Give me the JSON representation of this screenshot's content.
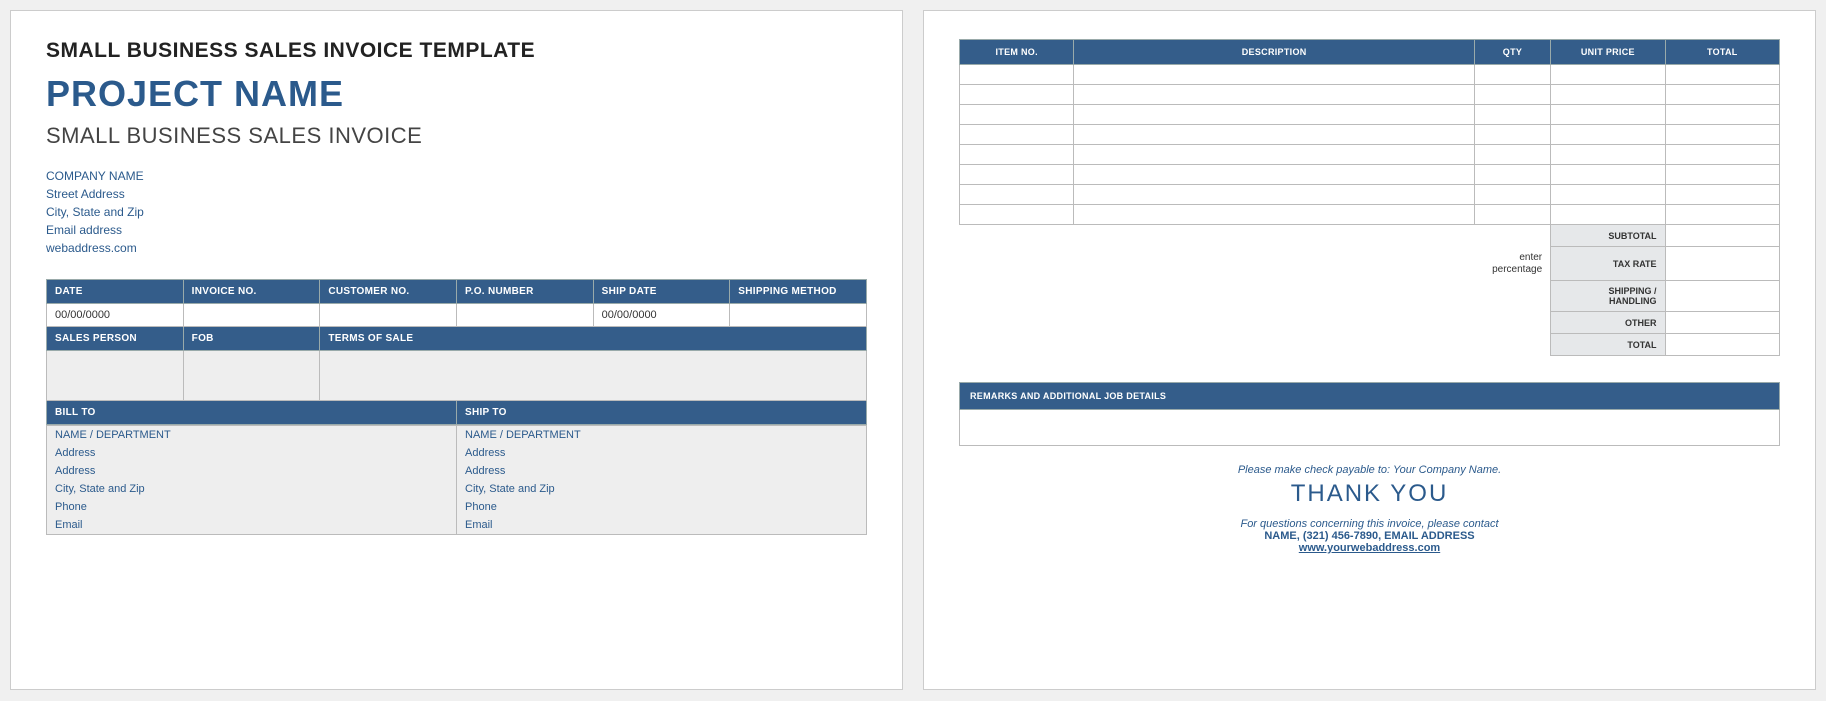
{
  "colors": {
    "accent": "#345d8a",
    "link": "#2b5a8c"
  },
  "page1": {
    "template_title": "SMALL BUSINESS SALES INVOICE TEMPLATE",
    "project_name": "PROJECT NAME",
    "subtitle": "SMALL BUSINESS SALES INVOICE",
    "company": {
      "name": "COMPANY NAME",
      "street": "Street Address",
      "city": "City, State and Zip",
      "email": "Email address",
      "web": "webaddress.com"
    },
    "headers1": [
      "DATE",
      "INVOICE NO.",
      "CUSTOMER NO.",
      "P.O. NUMBER",
      "SHIP DATE",
      "SHIPPING METHOD"
    ],
    "values1": [
      "00/00/0000",
      "",
      "",
      "",
      "00/00/0000",
      ""
    ],
    "headers2": [
      "SALES PERSON",
      "FOB",
      "TERMS OF SALE"
    ],
    "billto_label": "BILL TO",
    "shipto_label": "SHIP TO",
    "addr_lines": [
      "NAME / DEPARTMENT",
      "Address",
      "Address",
      "City, State and Zip",
      "Phone",
      "Email"
    ]
  },
  "page2": {
    "item_headers": [
      "ITEM NO.",
      "DESCRIPTION",
      "QTY",
      "UNIT PRICE",
      "TOTAL"
    ],
    "item_rows": 8,
    "totals": {
      "subtotal": "SUBTOTAL",
      "taxrate": "TAX RATE",
      "tax_note_line1": "enter",
      "tax_note_line2": "percentage",
      "shipping": "SHIPPING / HANDLING",
      "other": "OTHER",
      "total": "TOTAL"
    },
    "remarks_header": "REMARKS AND ADDITIONAL JOB DETAILS",
    "footer": {
      "payable_prefix": "Please make check payable to:",
      "payable_name": "Your Company Name.",
      "thank": "THANK YOU",
      "q_line": "For questions concerning this invoice, please contact",
      "contact": "NAME, (321) 456-7890, EMAIL ADDRESS",
      "web": "www.yourwebaddress.com"
    }
  }
}
